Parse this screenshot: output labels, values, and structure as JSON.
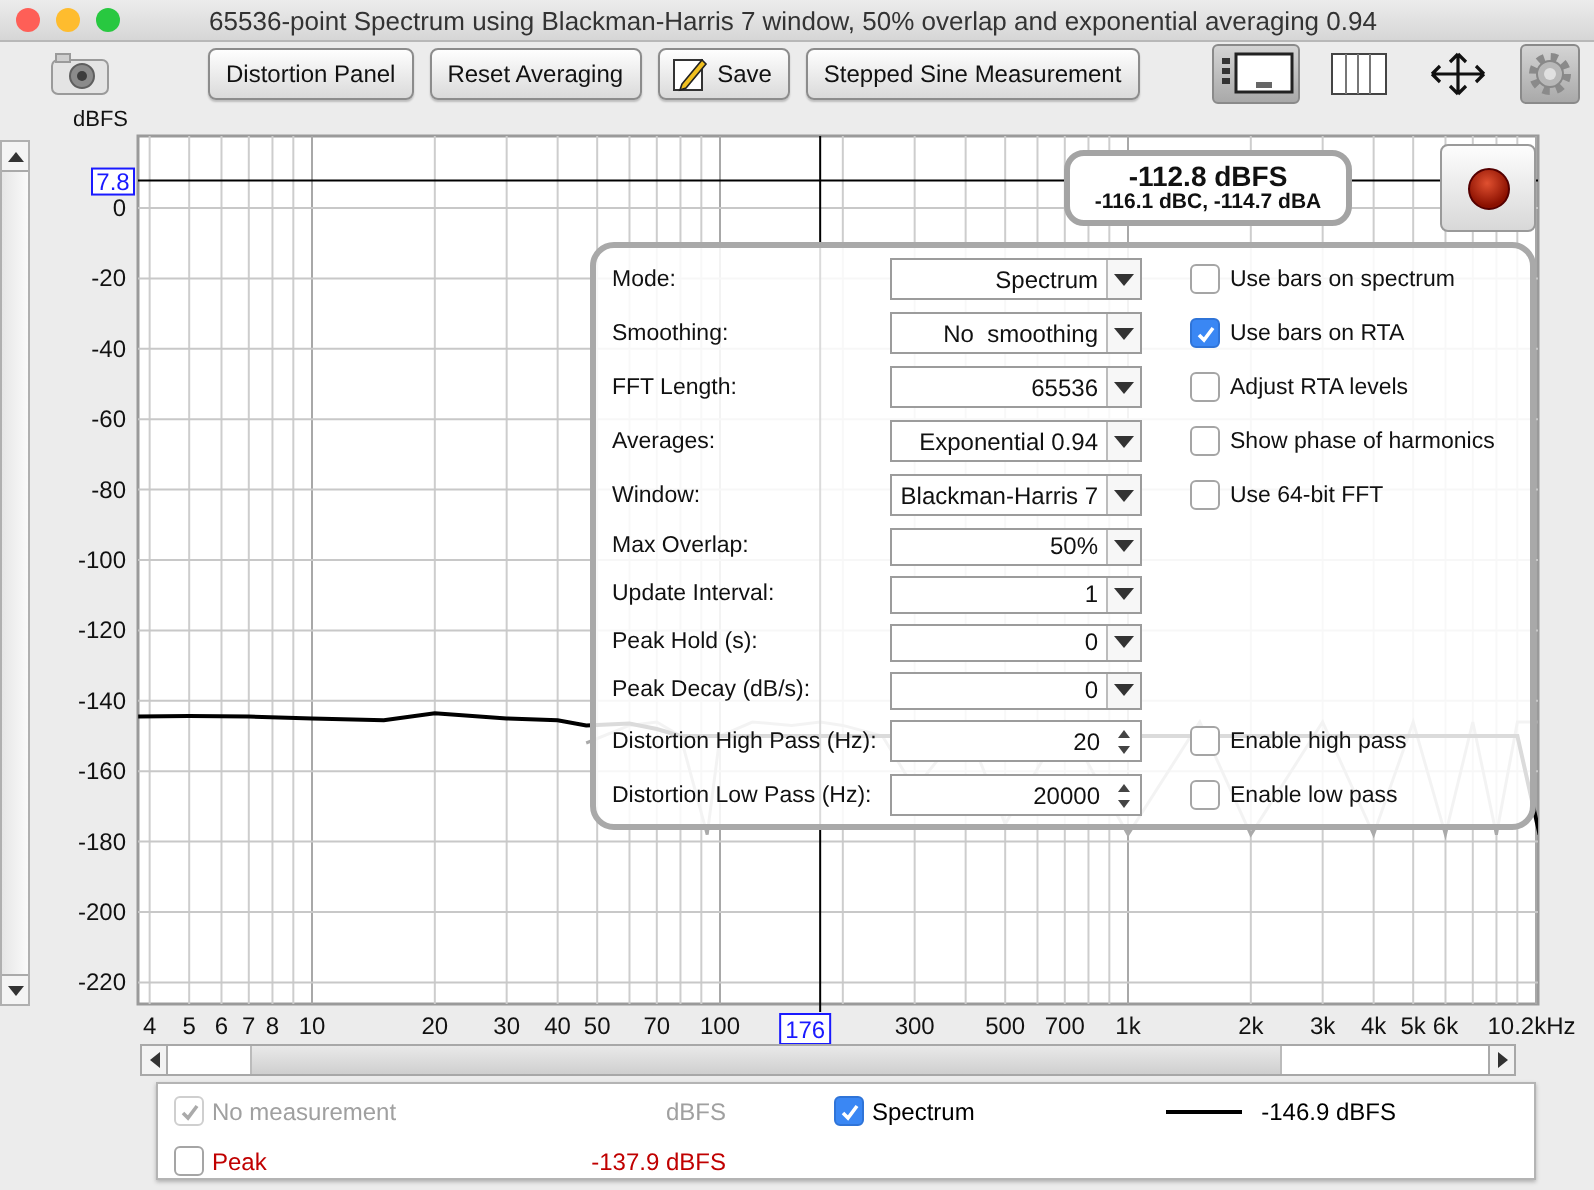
{
  "window": {
    "title": "65536-point Spectrum using Blackman-Harris 7 window, 50% overlap and exponential averaging 0.94"
  },
  "toolbar": {
    "buttons": [
      {
        "label": "Distortion Panel",
        "kind": "text"
      },
      {
        "label": "Reset Averaging",
        "kind": "text"
      },
      {
        "label": "Save",
        "kind": "icon"
      },
      {
        "label": "Stepped Sine Measurement",
        "kind": "text"
      }
    ],
    "tools": [
      {
        "kind": "layout",
        "selected": true
      },
      {
        "kind": "columns",
        "selected": false
      },
      {
        "kind": "move",
        "selected": false
      },
      {
        "kind": "settings",
        "selected": true
      }
    ]
  },
  "plot": {
    "y_axis": {
      "title": "dBFS",
      "ticks": [
        "0",
        "-20",
        "-40",
        "-60",
        "-80",
        "-100",
        "-120",
        "-140",
        "-160",
        "-180",
        "-200",
        "-220"
      ]
    },
    "x_axis": {
      "ticks": [
        "4",
        "5",
        "6",
        "7",
        "8",
        "10",
        "20",
        "30",
        "40",
        "50",
        "70",
        "100",
        "300",
        "500",
        "700",
        "1k",
        "2k",
        "3k",
        "4k",
        "5k",
        "6k",
        "10.2kHz"
      ]
    },
    "cursor": {
      "y_label": "7.8",
      "x_label": "176"
    },
    "readout": {
      "value": "-112.8 dBFS",
      "detail": "-116.1 dBC, -114.7 dBA"
    }
  },
  "settings_panel": {
    "rows": [
      {
        "label": "Mode:",
        "value": "Spectrum",
        "kind": "combo"
      },
      {
        "label": "Smoothing:",
        "value": "No  smoothing",
        "kind": "combo"
      },
      {
        "label": "FFT Length:",
        "value": "65536",
        "kind": "combo"
      },
      {
        "label": "Averages:",
        "value": "Exponential 0.94",
        "kind": "combo"
      },
      {
        "label": "Window:",
        "value": "Blackman-Harris 7",
        "kind": "combo"
      },
      {
        "label": "Max Overlap:",
        "value": "50%",
        "kind": "combo"
      },
      {
        "label": "Update Interval:",
        "value": "1",
        "kind": "combo"
      },
      {
        "label": "Peak Hold (s):",
        "value": "0",
        "kind": "combo"
      },
      {
        "label": "Peak Decay (dB/s):",
        "value": "0",
        "kind": "combo"
      },
      {
        "label": "Distortion High Pass (Hz):",
        "value": "20",
        "kind": "spinner"
      },
      {
        "label": "Distortion Low Pass (Hz):",
        "value": "20000",
        "kind": "spinner"
      }
    ],
    "options": [
      {
        "label": "Use bars on spectrum",
        "checked": false
      },
      {
        "label": "Use bars on RTA",
        "checked": true
      },
      {
        "label": "Adjust RTA levels",
        "checked": false
      },
      {
        "label": "Show phase of harmonics",
        "checked": false
      },
      {
        "label": "Use 64-bit FFT",
        "checked": false
      }
    ],
    "filter_options": [
      {
        "label": "Enable high pass",
        "checked": false
      },
      {
        "label": "Enable low pass",
        "checked": false
      }
    ]
  },
  "legend": {
    "items": [
      {
        "label": "No measurement",
        "value": "dBFS",
        "checked": true,
        "disabled": true,
        "kind": "plain"
      },
      {
        "label": "Spectrum",
        "value": "-146.9 dBFS",
        "checked": true,
        "disabled": false,
        "kind": "trace",
        "color": "#000000"
      },
      {
        "label": "Peak",
        "value": "-137.9 dBFS",
        "checked": false,
        "disabled": false,
        "kind": "plain",
        "color": "#c00000"
      }
    ]
  }
}
